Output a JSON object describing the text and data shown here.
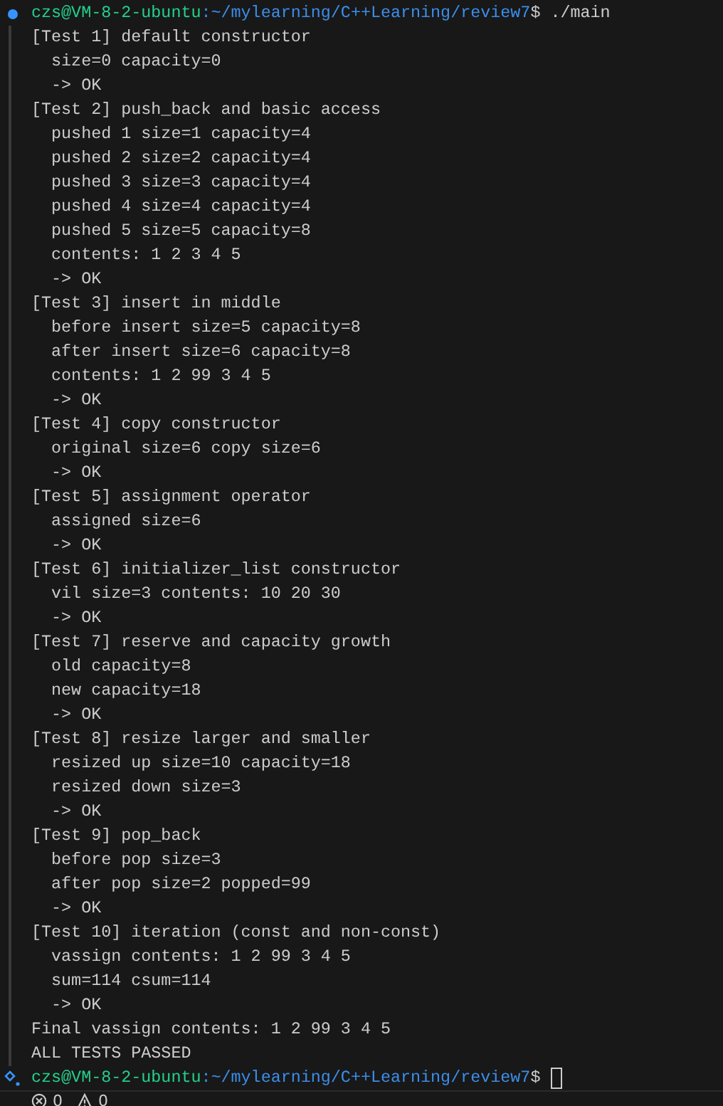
{
  "terminal": {
    "lines": [
      {
        "kind": "prompt",
        "user": "czs@VM-8-2-ubuntu",
        "path": ":~/mylearning/C++Learning/review7",
        "symbol": "$",
        "command": " ./main",
        "finished": true
      },
      {
        "kind": "output",
        "text": "[Test 1] default constructor"
      },
      {
        "kind": "output",
        "text": "  size=0 capacity=0"
      },
      {
        "kind": "output",
        "text": "  -> OK"
      },
      {
        "kind": "output",
        "text": "[Test 2] push_back and basic access"
      },
      {
        "kind": "output",
        "text": "  pushed 1 size=1 capacity=4"
      },
      {
        "kind": "output",
        "text": "  pushed 2 size=2 capacity=4"
      },
      {
        "kind": "output",
        "text": "  pushed 3 size=3 capacity=4"
      },
      {
        "kind": "output",
        "text": "  pushed 4 size=4 capacity=4"
      },
      {
        "kind": "output",
        "text": "  pushed 5 size=5 capacity=8"
      },
      {
        "kind": "output",
        "text": "  contents: 1 2 3 4 5"
      },
      {
        "kind": "output",
        "text": "  -> OK"
      },
      {
        "kind": "output",
        "text": "[Test 3] insert in middle"
      },
      {
        "kind": "output",
        "text": "  before insert size=5 capacity=8"
      },
      {
        "kind": "output",
        "text": "  after insert size=6 capacity=8"
      },
      {
        "kind": "output",
        "text": "  contents: 1 2 99 3 4 5"
      },
      {
        "kind": "output",
        "text": "  -> OK"
      },
      {
        "kind": "output",
        "text": "[Test 4] copy constructor"
      },
      {
        "kind": "output",
        "text": "  original size=6 copy size=6"
      },
      {
        "kind": "output",
        "text": "  -> OK"
      },
      {
        "kind": "output",
        "text": "[Test 5] assignment operator"
      },
      {
        "kind": "output",
        "text": "  assigned size=6"
      },
      {
        "kind": "output",
        "text": "  -> OK"
      },
      {
        "kind": "output",
        "text": "[Test 6] initializer_list constructor"
      },
      {
        "kind": "output",
        "text": "  vil size=3 contents: 10 20 30"
      },
      {
        "kind": "output",
        "text": "  -> OK"
      },
      {
        "kind": "output",
        "text": "[Test 7] reserve and capacity growth"
      },
      {
        "kind": "output",
        "text": "  old capacity=8"
      },
      {
        "kind": "output",
        "text": "  new capacity=18"
      },
      {
        "kind": "output",
        "text": "  -> OK"
      },
      {
        "kind": "output",
        "text": "[Test 8] resize larger and smaller"
      },
      {
        "kind": "output",
        "text": "  resized up size=10 capacity=18"
      },
      {
        "kind": "output",
        "text": "  resized down size=3"
      },
      {
        "kind": "output",
        "text": "  -> OK"
      },
      {
        "kind": "output",
        "text": "[Test 9] pop_back"
      },
      {
        "kind": "output",
        "text": "  before pop size=3"
      },
      {
        "kind": "output",
        "text": "  after pop size=2 popped=99"
      },
      {
        "kind": "output",
        "text": "  -> OK"
      },
      {
        "kind": "output",
        "text": "[Test 10] iteration (const and non-const)"
      },
      {
        "kind": "output",
        "text": "  vassign contents: 1 2 99 3 4 5"
      },
      {
        "kind": "output",
        "text": "  sum=114 csum=114"
      },
      {
        "kind": "output",
        "text": "  -> OK"
      },
      {
        "kind": "output",
        "text": "Final vassign contents: 1 2 99 3 4 5"
      },
      {
        "kind": "output",
        "text": "ALL TESTS PASSED"
      },
      {
        "kind": "prompt",
        "user": "czs@VM-8-2-ubuntu",
        "path": ":~/mylearning/C++Learning/review7",
        "symbol": "$",
        "finished": false,
        "cursor": true
      }
    ]
  },
  "status_bar": {
    "errors": "0",
    "warnings": "0"
  }
}
